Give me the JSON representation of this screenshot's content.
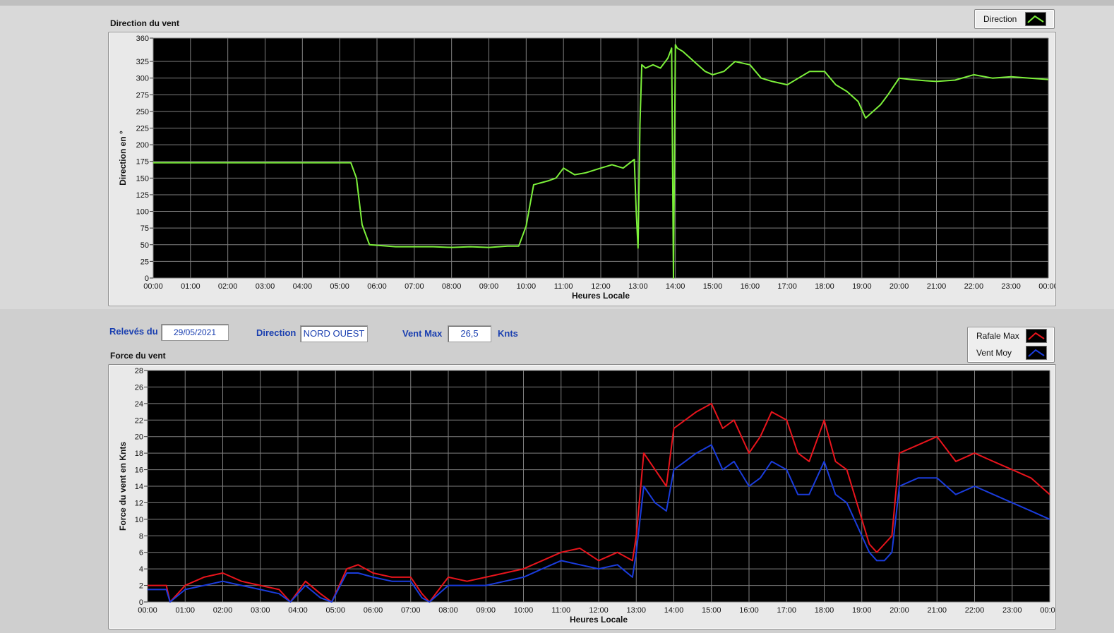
{
  "charts": {
    "direction": {
      "title": "Direction du vent",
      "ylabel": "Direction en °",
      "xlabel": "Heures Locale",
      "legend_label": "Direction"
    },
    "force": {
      "title": "Force du vent",
      "ylabel": "Force du vent en Knts",
      "xlabel": "Heures Locale",
      "legend_labels": [
        "Rafale Max",
        "Vent Moy"
      ]
    }
  },
  "fields": {
    "date_label": "Relevés du",
    "date_value": "29/05/2021",
    "direction_label": "Direction",
    "direction_value": "NORD OUEST",
    "ventmax_label": "Vent Max",
    "ventmax_value": "26,5",
    "ventmax_unit": "Knts"
  },
  "colors": {
    "direction": "#7cf03a",
    "rafale": "#e8141c",
    "moyen": "#1a3cdc",
    "plot_bg": "#000000",
    "grid": "#7f7f7f"
  },
  "chart_data": [
    {
      "type": "line",
      "title": "Direction du vent",
      "xlabel": "Heures Locale",
      "ylabel": "Direction en °",
      "x_ticks": [
        "00:00",
        "01:00",
        "02:00",
        "03:00",
        "04:00",
        "05:00",
        "06:00",
        "07:00",
        "08:00",
        "09:00",
        "10:00",
        "11:00",
        "12:00",
        "13:00",
        "14:00",
        "15:00",
        "16:00",
        "17:00",
        "18:00",
        "19:00",
        "20:00",
        "21:00",
        "22:00",
        "23:00",
        "00:00"
      ],
      "y_ticks": [
        0,
        25,
        50,
        75,
        100,
        125,
        150,
        175,
        200,
        225,
        250,
        275,
        300,
        325,
        360
      ],
      "xlim": [
        0,
        24
      ],
      "ylim": [
        0,
        360
      ],
      "legend": "top-right",
      "series": [
        {
          "name": "Direction",
          "x": [
            0,
            5.3,
            5.45,
            5.6,
            5.8,
            6.5,
            7.5,
            8,
            8.5,
            9,
            9.5,
            9.8,
            10.0,
            10.2,
            10.6,
            10.8,
            11.0,
            11.3,
            11.6,
            12.0,
            12.3,
            12.6,
            12.9,
            12.95,
            13.0,
            13.05,
            13.1,
            13.2,
            13.4,
            13.6,
            13.8,
            13.9,
            13.95,
            14.0,
            14.05,
            14.2,
            14.5,
            14.8,
            15.0,
            15.3,
            15.6,
            16.0,
            16.3,
            16.6,
            17.0,
            17.3,
            17.6,
            18.0,
            18.3,
            18.6,
            18.9,
            19.1,
            19.3,
            19.5,
            19.7,
            20.0,
            20.3,
            20.7,
            21.0,
            21.5,
            22.0,
            22.5,
            23.0,
            23.5,
            24.0
          ],
          "y": [
            173,
            173,
            150,
            80,
            50,
            47,
            47,
            46,
            47,
            46,
            48,
            48,
            78,
            140,
            146,
            150,
            165,
            155,
            158,
            165,
            170,
            165,
            178,
            100,
            45,
            230,
            320,
            315,
            320,
            315,
            330,
            345,
            0,
            350,
            345,
            340,
            325,
            310,
            305,
            310,
            325,
            320,
            300,
            295,
            290,
            300,
            310,
            310,
            290,
            280,
            265,
            240,
            250,
            260,
            275,
            300,
            298,
            296,
            295,
            297,
            305,
            300,
            302,
            300,
            298
          ]
        }
      ]
    },
    {
      "type": "line",
      "title": "Force du vent",
      "xlabel": "Heures Locale",
      "ylabel": "Force du vent en Knts",
      "x_ticks": [
        "00:00",
        "01:00",
        "02:00",
        "03:00",
        "04:00",
        "05:00",
        "06:00",
        "07:00",
        "08:00",
        "09:00",
        "10:00",
        "11:00",
        "12:00",
        "13:00",
        "14:00",
        "15:00",
        "16:00",
        "17:00",
        "18:00",
        "19:00",
        "20:00",
        "21:00",
        "22:00",
        "23:00",
        "00:00"
      ],
      "y_ticks": [
        0,
        2,
        4,
        6,
        8,
        10,
        12,
        14,
        16,
        18,
        20,
        22,
        24,
        26,
        28
      ],
      "xlim": [
        0,
        24
      ],
      "ylim": [
        0,
        28
      ],
      "legend": "top-right",
      "series": [
        {
          "name": "Rafale Max",
          "x": [
            0,
            0.5,
            0.6,
            1.0,
            1.5,
            2.0,
            2.5,
            3.0,
            3.5,
            3.8,
            4.2,
            4.6,
            4.9,
            5.3,
            5.6,
            6.0,
            6.5,
            7.0,
            7.3,
            7.5,
            8.0,
            8.5,
            9.0,
            9.5,
            10.0,
            10.5,
            11.0,
            11.5,
            12.0,
            12.5,
            12.9,
            13.0,
            13.2,
            13.5,
            13.8,
            14.0,
            14.3,
            14.6,
            15.0,
            15.3,
            15.6,
            16.0,
            16.3,
            16.6,
            17.0,
            17.3,
            17.6,
            18.0,
            18.3,
            18.6,
            19.0,
            19.2,
            19.4,
            19.6,
            19.8,
            20.0,
            20.5,
            21.0,
            21.5,
            22.0,
            22.5,
            23.0,
            23.5,
            24.0
          ],
          "y": [
            2,
            2,
            0,
            2,
            3,
            3.5,
            2.5,
            2,
            1.5,
            0,
            2.5,
            1,
            0,
            4,
            4.5,
            3.5,
            3,
            3,
            1,
            0,
            3,
            2.5,
            3,
            3.5,
            4,
            5,
            6,
            6.5,
            5,
            6,
            5,
            8,
            18,
            16,
            14,
            21,
            22,
            23,
            24,
            21,
            22,
            18,
            20,
            23,
            22,
            18,
            17,
            22,
            17,
            16,
            10,
            7,
            6,
            7,
            8,
            18,
            19,
            20,
            17,
            18,
            17,
            16,
            15,
            13
          ]
        },
        {
          "name": "Vent Moy",
          "x": [
            0,
            0.5,
            0.6,
            1.0,
            1.5,
            2.0,
            2.5,
            3.0,
            3.5,
            3.8,
            4.2,
            4.6,
            4.9,
            5.3,
            5.6,
            6.0,
            6.5,
            7.0,
            7.3,
            7.5,
            8.0,
            8.5,
            9.0,
            9.5,
            10.0,
            10.5,
            11.0,
            11.5,
            12.0,
            12.5,
            12.9,
            13.0,
            13.2,
            13.5,
            13.8,
            14.0,
            14.3,
            14.6,
            15.0,
            15.3,
            15.6,
            16.0,
            16.3,
            16.6,
            17.0,
            17.3,
            17.6,
            18.0,
            18.3,
            18.6,
            19.0,
            19.2,
            19.4,
            19.6,
            19.8,
            20.0,
            20.5,
            21.0,
            21.5,
            22.0,
            22.5,
            23.0,
            23.5,
            24.0
          ],
          "y": [
            1.5,
            1.5,
            0,
            1.5,
            2,
            2.5,
            2,
            1.5,
            1,
            0,
            2,
            0.5,
            0,
            3.5,
            3.5,
            3,
            2.5,
            2.5,
            0.5,
            0,
            2,
            2,
            2,
            2.5,
            3,
            4,
            5,
            4.5,
            4,
            4.5,
            3,
            6,
            14,
            12,
            11,
            16,
            17,
            18,
            19,
            16,
            17,
            14,
            15,
            17,
            16,
            13,
            13,
            17,
            13,
            12,
            8,
            6,
            5,
            5,
            6,
            14,
            15,
            15,
            13,
            14,
            13,
            12,
            11,
            10
          ]
        }
      ]
    }
  ]
}
